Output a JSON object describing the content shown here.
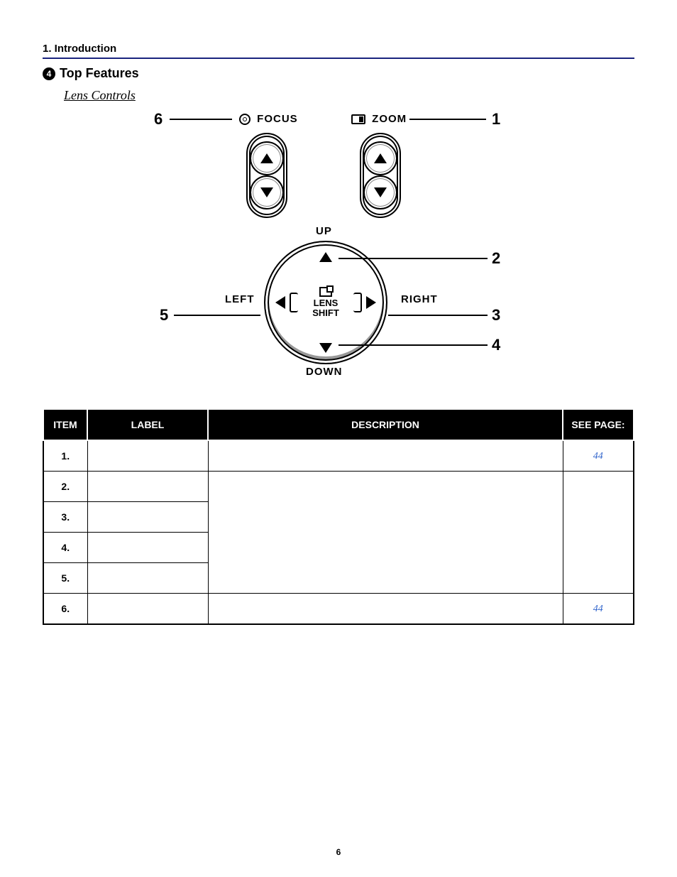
{
  "chapter": "1. Introduction",
  "section_number": "4",
  "section_title": "Top Features",
  "subsection": "Lens Controls",
  "diagram": {
    "focus_label": "FOCUS",
    "zoom_label": "ZOOM",
    "up_label": "UP",
    "down_label": "DOWN",
    "left_label": "LEFT",
    "right_label": "RIGHT",
    "lens_shift_line1": "LENS",
    "lens_shift_line2": "SHIFT",
    "callouts": {
      "c1": "1",
      "c2": "2",
      "c3": "3",
      "c4": "4",
      "c5": "5",
      "c6": "6"
    }
  },
  "table": {
    "headers": {
      "item": "ITEM",
      "label": "LABEL",
      "description": "DESCRIPTION",
      "page": "SEE PAGE:"
    },
    "rows": [
      {
        "num": "1.",
        "label": "",
        "description": "",
        "page": "44"
      },
      {
        "num": "2.",
        "label": "",
        "description": "",
        "page": ""
      },
      {
        "num": "3.",
        "label": "",
        "description": "",
        "page": ""
      },
      {
        "num": "4.",
        "label": "",
        "description": "",
        "page": ""
      },
      {
        "num": "5.",
        "label": "",
        "description": "",
        "page": ""
      },
      {
        "num": "6.",
        "label": "",
        "description": "",
        "page": "44"
      }
    ]
  },
  "page_number": "6"
}
